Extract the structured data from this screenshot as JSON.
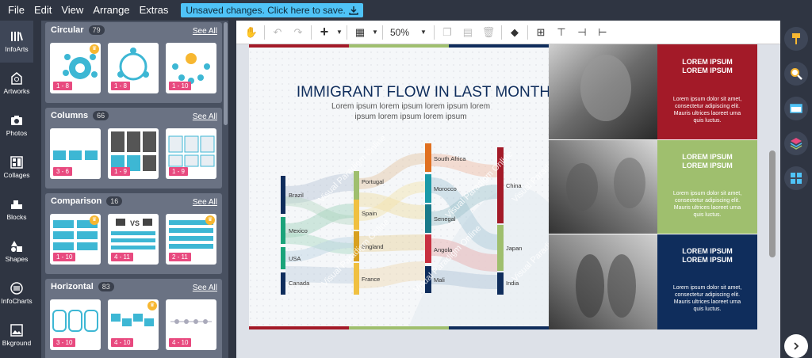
{
  "menu": {
    "items": [
      "File",
      "Edit",
      "View",
      "Arrange",
      "Extras"
    ],
    "save_banner": "Unsaved changes. Click here to save."
  },
  "nav": {
    "items": [
      {
        "label": "InfoArts",
        "icon": "infoarts-icon"
      },
      {
        "label": "Artworks",
        "icon": "artworks-icon"
      },
      {
        "label": "Photos",
        "icon": "camera-icon"
      },
      {
        "label": "Collages",
        "icon": "collages-icon"
      },
      {
        "label": "Blocks",
        "icon": "blocks-icon"
      },
      {
        "label": "Shapes",
        "icon": "shapes-icon"
      },
      {
        "label": "InfoCharts",
        "icon": "infocharts-icon"
      },
      {
        "label": "Bkground",
        "icon": "background-icon"
      }
    ]
  },
  "panel": {
    "see_all": "See All",
    "categories": [
      {
        "name": "Circular",
        "count": "79",
        "thumbs": [
          {
            "range": "1 - 8",
            "crown": true
          },
          {
            "range": "1 - 8",
            "crown": false
          },
          {
            "range": "1 - 10",
            "crown": false
          }
        ]
      },
      {
        "name": "Columns",
        "count": "66",
        "thumbs": [
          {
            "range": "3 - 6",
            "crown": false
          },
          {
            "range": "1 - 9",
            "crown": false
          },
          {
            "range": "1 - 9",
            "crown": false
          }
        ]
      },
      {
        "name": "Comparison",
        "count": "16",
        "thumbs": [
          {
            "range": "1 - 10",
            "crown": true
          },
          {
            "range": "4 - 11",
            "crown": false
          },
          {
            "range": "2 - 11",
            "crown": true
          }
        ]
      },
      {
        "name": "Horizontal",
        "count": "83",
        "thumbs": [
          {
            "range": "3 - 10",
            "crown": false
          },
          {
            "range": "4 - 10",
            "crown": true
          },
          {
            "range": "4 - 10",
            "crown": false
          }
        ]
      }
    ]
  },
  "toolbar": {
    "zoom": "50%"
  },
  "design": {
    "title": "IMMIGRANT FLOW IN LAST MONTH",
    "subtitle1": "Lorem ipsum lorem ipsum lorem ipsum lorem",
    "subtitle2": "ipsum lorem ipsum lorem ipsum",
    "sources": [
      "Brazil",
      "Mexico",
      "USA",
      "Canada"
    ],
    "mid1": [
      "Portugal",
      "Spain",
      "England",
      "France"
    ],
    "mid2": [
      "South Africa",
      "Morocco",
      "Senegal",
      "Angola",
      "Mali"
    ],
    "targets": [
      "China",
      "Japan",
      "India"
    ],
    "watermark": "Visual Paradigm Online",
    "cards": [
      {
        "title1": "LOREM IPSUM",
        "title2": "LOREM IPSUM",
        "body": [
          "Lorem ipsum dolor sit amet,",
          "consectetur adipiscing elit.",
          "Mauris ultrices laoreet urna",
          "quis luctus."
        ],
        "color": "#a31a28"
      },
      {
        "title1": "LOREM IPSUM",
        "title2": "LOREM IPSUM",
        "body": [
          "Lorem ipsum dolor sit amet,",
          "consectetur adipiscing elit.",
          "Mauris ultrices laoreet urna",
          "quis luctus."
        ],
        "color": "#9fbf6e"
      },
      {
        "title1": "LOREM IPSUM",
        "title2": "LOREM IPSUM",
        "body": [
          "Lorem ipsum dolor sit amet,",
          "consectetur adipiscing elit.",
          "Mauris ultrices laoreet urna",
          "quis luctus."
        ],
        "color": "#0f2d5c"
      }
    ]
  },
  "colors": {
    "accent": "#4fc3f7",
    "pink": "#e84a7f",
    "dark": "#2f3542",
    "red": "#a31a28",
    "green": "#9fbf6e",
    "navy": "#0f2d5c"
  }
}
